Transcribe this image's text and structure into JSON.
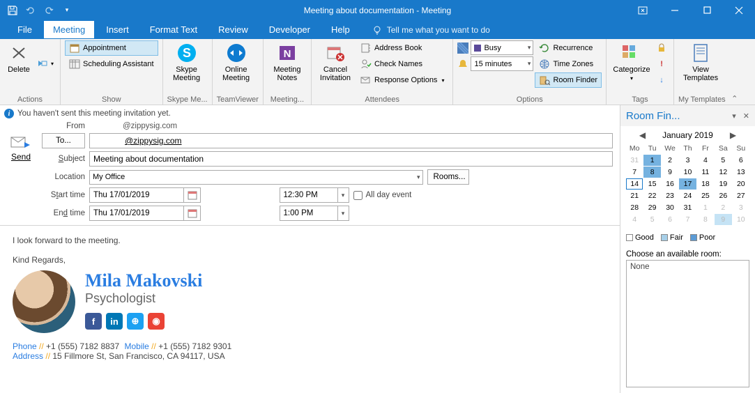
{
  "title": "Meeting about documentation  -  Meeting",
  "qat": {
    "down": "▾"
  },
  "tabs": [
    "File",
    "Meeting",
    "Insert",
    "Format Text",
    "Review",
    "Developer",
    "Help"
  ],
  "tellme": "Tell me what you want to do",
  "ribbon": {
    "actions": {
      "delete": "Delete",
      "label": "Actions"
    },
    "show": {
      "appointment": "Appointment",
      "scheduling": "Scheduling Assistant",
      "label": "Show"
    },
    "skype": {
      "btn": "Skype\nMeeting",
      "label": "Skype Me..."
    },
    "tv": {
      "btn": "Online\nMeeting",
      "label": "TeamViewer"
    },
    "notes": {
      "btn": "Meeting\nNotes",
      "label": "Meeting..."
    },
    "cancel": {
      "btn": "Cancel\nInvitation"
    },
    "attendees": {
      "address": "Address Book",
      "check": "Check Names",
      "response": "Response Options",
      "label": "Attendees"
    },
    "options": {
      "busy": "Busy",
      "reminder": "15 minutes",
      "recurrence": "Recurrence",
      "timezones": "Time Zones",
      "roomfinder": "Room Finder",
      "label": "Options"
    },
    "tags": {
      "categorize": "Categorize",
      "label": "Tags"
    },
    "templates": {
      "btn": "View\nTemplates",
      "label": "My Templates"
    }
  },
  "info": "You haven't sent this meeting invitation yet.",
  "form": {
    "from_label": "From",
    "from_value": "@zippysig.com",
    "to_label": "To...",
    "to_value": "@zippysig.com",
    "subject_label": "Subject",
    "subject_value": "Meeting about documentation",
    "location_label": "Location",
    "location_value": "My Office",
    "rooms_btn": "Rooms...",
    "start_label": "Start time",
    "end_label": "End time",
    "date_value": "Thu 17/01/2019",
    "start_time": "12:30 PM",
    "end_time": "1:00 PM",
    "allday": "All day event",
    "send": "Send"
  },
  "body": {
    "line1": "I look forward to the meeting.",
    "line2": "Kind Regards,",
    "name": "Mila Makovski",
    "title": "Psychologist",
    "phone_lbl": "Phone",
    "phone": "+1 (555) 7182 8837",
    "mobile_lbl": "Mobile",
    "mobile": "+1 (555) 7182 9301",
    "addr_lbl": "Address",
    "addr": "15 Fillmore St, San Francisco, CA 94117, USA",
    "sep": " // "
  },
  "roompane": {
    "title": "Room Fin...",
    "month": "January 2019",
    "days": [
      "Mo",
      "Tu",
      "We",
      "Th",
      "Fr",
      "Sa",
      "Su"
    ],
    "good": "Good",
    "fair": "Fair",
    "poor": "Poor",
    "choose": "Choose an available room:",
    "none": "None"
  }
}
